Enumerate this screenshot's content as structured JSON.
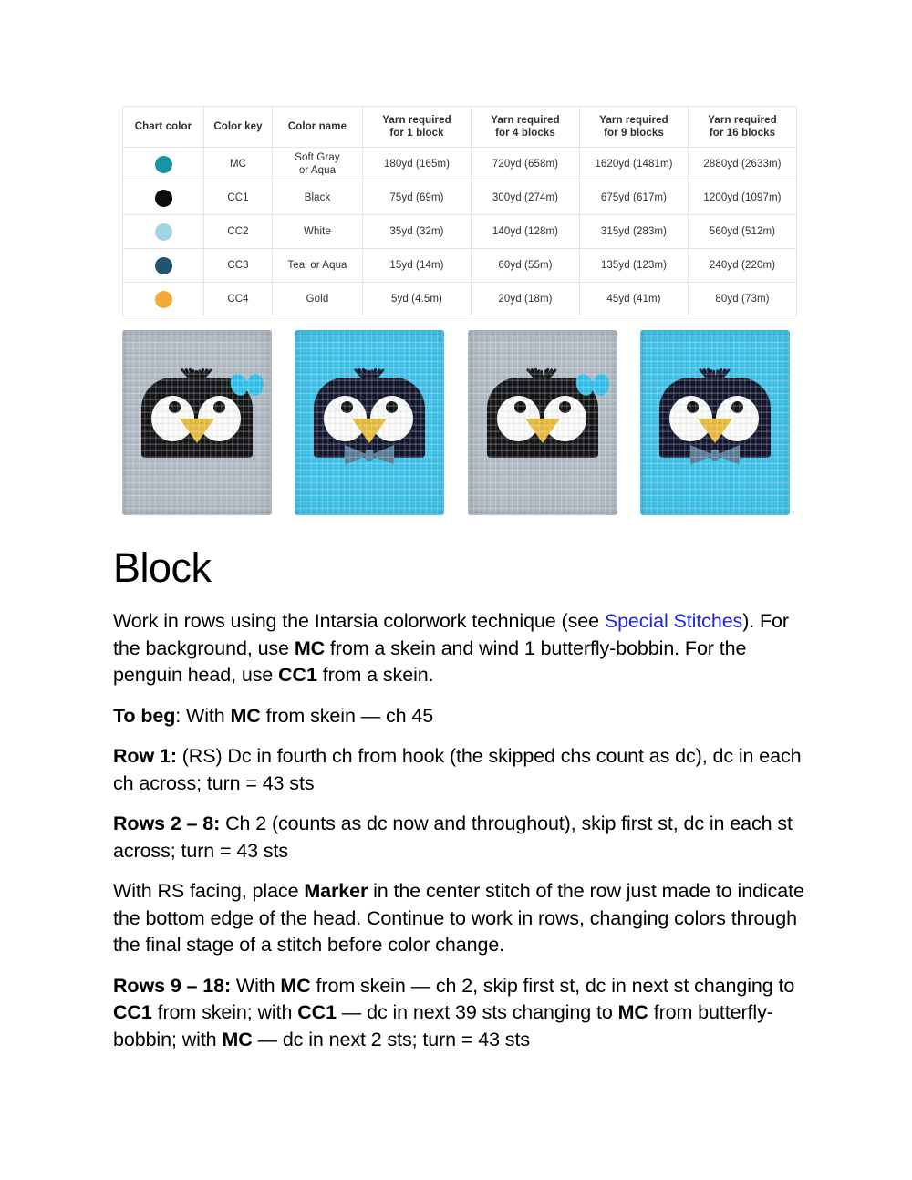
{
  "table": {
    "headers": [
      "Chart color",
      "Color key",
      "Color name",
      "Yarn required\nfor 1 block",
      "Yarn required\nfor 4 blocks",
      "Yarn required\nfor 9 blocks",
      "Yarn required\nfor 16 blocks"
    ],
    "headers_flat": [
      "Chart color",
      "Color key",
      "Color name",
      "Yarn required for 1 block",
      "Yarn required for 4 blocks",
      "Yarn required for 9 blocks",
      "Yarn required for 16 blocks"
    ],
    "header_lines": [
      {
        "l1": "Chart color",
        "l2": ""
      },
      {
        "l1": "Color key",
        "l2": ""
      },
      {
        "l1": "Color name",
        "l2": ""
      },
      {
        "l1": "Yarn required",
        "l2": "for 1 block"
      },
      {
        "l1": "Yarn required",
        "l2": "for 4 blocks"
      },
      {
        "l1": "Yarn required",
        "l2": "for 9 blocks"
      },
      {
        "l1": "Yarn required",
        "l2": "for 16 blocks"
      }
    ],
    "rows": [
      {
        "swatch_color": "#1a93a8",
        "key": "MC",
        "name_l1": "Soft Gray",
        "name_l2": "or Aqua",
        "name": "Soft Gray or Aqua",
        "yarn_1": "180yd (165m)",
        "yarn_4": "720yd (658m)",
        "yarn_9": "1620yd (1481m)",
        "yarn_16": "2880yd (2633m)"
      },
      {
        "swatch_color": "#0b0b0b",
        "key": "CC1",
        "name_l1": "Black",
        "name_l2": "",
        "name": "Black",
        "yarn_1": "75yd (69m)",
        "yarn_4": "300yd (274m)",
        "yarn_9": "675yd (617m)",
        "yarn_16": "1200yd (1097m)"
      },
      {
        "swatch_color": "#a0d6e3",
        "key": "CC2",
        "name_l1": "White",
        "name_l2": "",
        "name": "White",
        "yarn_1": "35yd (32m)",
        "yarn_4": "140yd (128m)",
        "yarn_9": "315yd (283m)",
        "yarn_16": "560yd (512m)"
      },
      {
        "swatch_color": "#23546f",
        "key": "CC3",
        "name_l1": "Teal or Aqua",
        "name_l2": "",
        "name": "Teal or Aqua",
        "yarn_1": "15yd (14m)",
        "yarn_4": "60yd (55m)",
        "yarn_9": "135yd (123m)",
        "yarn_16": "240yd (220m)"
      },
      {
        "swatch_color": "#f3a935",
        "key": "CC4",
        "name_l1": "Gold",
        "name_l2": "",
        "name": "Gold",
        "yarn_1": "5yd (4.5m)",
        "yarn_4": "20yd (18m)",
        "yarn_9": "45yd (41m)",
        "yarn_16": "80yd (73m)"
      }
    ]
  },
  "photos": [
    {
      "name": "penguin-block-gray-bow",
      "background_color": "#b3bcc6",
      "head_color": "#141518",
      "eye_color": "#fbfbfa",
      "pupil_color": "#111214",
      "beak_color": "#e8bc3c",
      "accessory": "bow",
      "accessory_color": "#2ec3ef"
    },
    {
      "name": "penguin-block-aqua-bowtie",
      "background_color": "#3fc4ec",
      "head_color": "#12172e",
      "eye_color": "#fbfbfa",
      "pupil_color": "#111214",
      "beak_color": "#e8bc3c",
      "accessory": "bowtie",
      "accessory_color": "#5b7e99"
    },
    {
      "name": "penguin-block-gray-bow-2",
      "background_color": "#b3bcc6",
      "head_color": "#141518",
      "eye_color": "#fbfbfa",
      "pupil_color": "#111214",
      "beak_color": "#e8bc3c",
      "accessory": "bow",
      "accessory_color": "#2ec3ef"
    },
    {
      "name": "penguin-block-aqua-bowtie-2",
      "background_color": "#3fc4ec",
      "head_color": "#12172e",
      "eye_color": "#fbfbfa",
      "pupil_color": "#111214",
      "beak_color": "#e8bc3c",
      "accessory": "bowtie",
      "accessory_color": "#5b7e99"
    }
  ],
  "content": {
    "title": "Block",
    "link_color": "#1d24e8",
    "paragraphs": {
      "intro": {
        "p1": "Work in rows using the Intarsia colorwork technique (see ",
        "link": "Special Stitches",
        "p2": "). For the background, use ",
        "b1": "MC",
        "p3": " from a skein and wind 1 butterfly-bobbin. For the penguin head, use ",
        "b2": "CC1",
        "p4": " from a skein."
      },
      "to_beg": {
        "label": "To beg",
        "t1": ": With ",
        "b1": "MC",
        "t2": " from skein — ch 45"
      },
      "row1": {
        "label": "Row 1:",
        "t1": " (RS) Dc in fourth ch from hook (the skipped chs count as dc), dc in each ch across; turn = 43 sts"
      },
      "rows2_8": {
        "label": "Rows 2 – 8:",
        "t1": " Ch 2 (counts as dc now and throughout), skip first st, dc in each st across; turn = 43 sts"
      },
      "marker": {
        "t1": "With RS facing, place ",
        "b1": "Marker",
        "t2": " in the center stitch of the row just made to indicate the bottom edge of the head. Continue to work in rows, changing colors through the final stage of a stitch before color change."
      },
      "rows9_18": {
        "label": "Rows 9 – 18:",
        "t1": " With ",
        "b1": "MC",
        "t2": " from skein — ch 2, skip first st, dc in next st changing to ",
        "b2": "CC1",
        "t3": " from skein; with ",
        "b3": "CC1",
        "t4": " — dc in next 39 sts changing to ",
        "b4": "MC",
        "t5": " from butterfly-bobbin; with ",
        "b5": "MC",
        "t6": " — dc in next 2 sts; turn = 43 sts"
      }
    }
  }
}
